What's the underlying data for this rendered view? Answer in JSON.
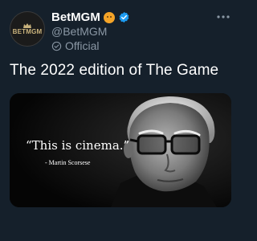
{
  "account": {
    "display_name": "BetMGM",
    "handle": "@BetMGM",
    "affiliation": "Official",
    "avatar_logo": "BETMGM",
    "emoji_icon": "lion-face-icon",
    "verified_icon": "verified-badge-icon"
  },
  "menu": {
    "more_icon": "more-options-icon"
  },
  "tweet": {
    "text": "The 2022 edition of The Game"
  },
  "media": {
    "quote": "“This is cinema.”",
    "attribution": "- Martin Scorsese"
  },
  "colors": {
    "background": "#15202b",
    "secondary_text": "#8b98a5",
    "verified_blue": "#1d9bf0"
  }
}
